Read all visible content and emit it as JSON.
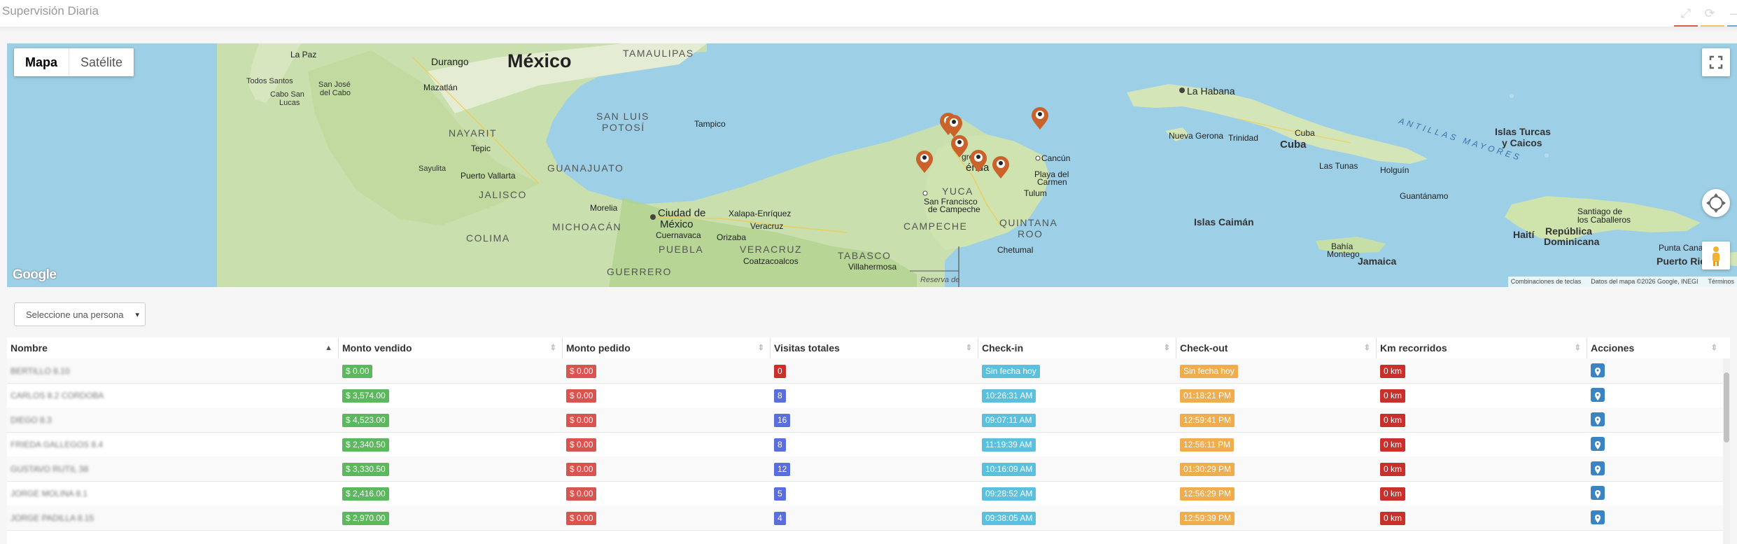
{
  "window": {
    "title": "Supervisión Diaria",
    "bar_colors": [
      "#e05a47",
      "#f3c36c",
      "#6aa8d8"
    ]
  },
  "map": {
    "toggle": {
      "map": "Mapa",
      "satellite": "Satélite"
    },
    "logo": "Google",
    "attribution": {
      "shortcuts": "Combinaciones de teclas",
      "data": "Datos del mapa ©2026 Google, INEGI",
      "terms": "Términos"
    },
    "labels": {
      "mexico": "México",
      "tamaulipas": "TAMAULIPAS",
      "nayarit": "NAYARIT",
      "san_luis": "SAN LUIS",
      "potosi": "POTOSÍ",
      "guanajuato": "GUANAJUATO",
      "jalisco": "JALISCO",
      "michoacan": "MICHOACÁN",
      "colima": "COLIMA",
      "guerrero": "GUERRERO",
      "puebla": "PUEBLA",
      "veracruz": "VERACRUZ",
      "tabasco": "TABASCO",
      "campeche": "CAMPECHE",
      "quintana": "QUINTANA",
      "roo": "ROO",
      "yuca": "YUCA",
      "durango": "Durango",
      "la_paz": "La Paz",
      "todos_santos": "Todos Santos",
      "san_jose": "San José",
      "del_cabo": "del Cabo",
      "cabo_san": "Cabo San",
      "lucas": "Lucas",
      "mazatlan": "Mazatlán",
      "tepic": "Tepic",
      "sayulita": "Sayulita",
      "puerto_vallarta": "Puerto Vallarta",
      "morelia": "Morelia",
      "ciudad_de": "Ciudad de",
      "mexico_city": "México",
      "cuernavaca": "Cuernavaca",
      "orizaba": "Orizaba",
      "xalapa": "Xalapa-Enríquez",
      "veracruz_city": "Veracruz",
      "coatzacoalcos": "Coatzacoalcos",
      "villahermosa": "Villahermosa",
      "tampico": "Tampico",
      "progreso": "greso",
      "merida": "érida",
      "san_francisco": "San Francisco",
      "de_campeche": "de Campeche",
      "cancun": "Cancún",
      "playa": "Playa del",
      "carmen": "Carmen",
      "tulum": "Tulum",
      "chetumal": "Chetumal",
      "reserva": "Reserva de",
      "la_habana": "La Habana",
      "nueva_gerona": "Nueva Gerona",
      "trinidad": "Trinidad",
      "cuba": "Cuba",
      "cuba_city": "Cuba",
      "las_tunas": "Las Tunas",
      "holguin": "Holguín",
      "guantanamo": "Guantánamo",
      "islas_caiman": "Islas Caimán",
      "jamaica": "Jamaica",
      "bahia": "Bahía",
      "montego": "Montego",
      "antillas": "ANTILLAS MAYORES",
      "islas_turcas": "Islas Turcas",
      "y_caicos": "y Caicos",
      "haiti": "Haití",
      "republica": "República",
      "dominicana": "Dominicana",
      "santiago": "Santiago de",
      "los_caballeros": "los Caballeros",
      "punta_cana": "Punta Cana",
      "puerto_rico": "Puerto Rico"
    }
  },
  "filter": {
    "person_placeholder": "Seleccione una persona"
  },
  "table": {
    "headers": [
      "Nombre",
      "Monto vendido",
      "Monto pedido",
      "Visitas totales",
      "Check-in",
      "Check-out",
      "Km recorridos",
      "Acciones"
    ],
    "rows": [
      {
        "name": "BERTILLO 8.10",
        "sold": "$ 0.00",
        "ordered": "$ 0.00",
        "visits": "0",
        "checkin": "Sin fecha hoy",
        "checkout": "Sin fecha hoy",
        "km": "0 km"
      },
      {
        "name": "CARLOS 8.2 CORDOBA",
        "sold": "$ 3,574.00",
        "ordered": "$ 0.00",
        "visits": "8",
        "checkin": "10:26:31 AM",
        "checkout": "01:18:21 PM",
        "km": "0 km"
      },
      {
        "name": "DIEGO 8.3",
        "sold": "$ 4,523.00",
        "ordered": "$ 0.00",
        "visits": "16",
        "checkin": "09:07:11 AM",
        "checkout": "12:59:41 PM",
        "km": "0 km"
      },
      {
        "name": "FRIEDA GALLEGOS 8.4",
        "sold": "$ 2,340.50",
        "ordered": "$ 0.00",
        "visits": "8",
        "checkin": "11:19:39 AM",
        "checkout": "12:56:11 PM",
        "km": "0 km"
      },
      {
        "name": "GUSTAVO RUTIL 38",
        "sold": "$ 3,330.50",
        "ordered": "$ 0.00",
        "visits": "12",
        "checkin": "10:16:09 AM",
        "checkout": "01:30:29 PM",
        "km": "0 km"
      },
      {
        "name": "JORGE MOLINA 8.1",
        "sold": "$ 2,416.00",
        "ordered": "$ 0.00",
        "visits": "5",
        "checkin": "09:28:52 AM",
        "checkout": "12:56:29 PM",
        "km": "0 km"
      },
      {
        "name": "JORGE PADILLA 8.15",
        "sold": "$ 2,970.00",
        "ordered": "$ 0.00",
        "visits": "4",
        "checkin": "09:38:05 AM",
        "checkout": "12:59:39 PM",
        "km": "0 km"
      }
    ]
  }
}
